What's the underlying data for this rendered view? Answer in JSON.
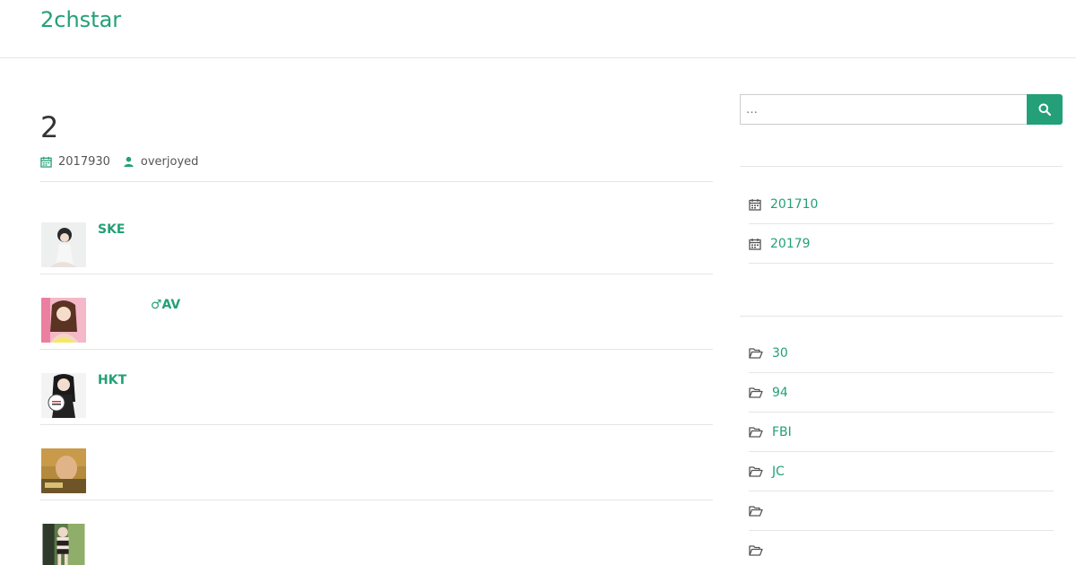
{
  "site": {
    "title": "2chstar"
  },
  "article": {
    "title": "2",
    "date": "2017930",
    "author": "overjoyed"
  },
  "posts": [
    {
      "title": "SKE"
    },
    {
      "title": "♂AV"
    },
    {
      "title": "HKT"
    },
    {
      "title": ""
    },
    {
      "title": ""
    }
  ],
  "search": {
    "placeholder": "…"
  },
  "archives": [
    {
      "label": "201710"
    },
    {
      "label": "20179"
    }
  ],
  "categories": [
    {
      "label": "30"
    },
    {
      "label": "94"
    },
    {
      "label": "FBI"
    },
    {
      "label": "JC"
    },
    {
      "label": ""
    },
    {
      "label": ""
    }
  ],
  "colors": {
    "accent": "#23a078",
    "rule": "#e5e5e5"
  },
  "icons": {
    "date": "calendar-icon",
    "author": "user-icon",
    "search": "search-icon",
    "archive": "calendar-icon",
    "category": "folder-open-icon"
  }
}
